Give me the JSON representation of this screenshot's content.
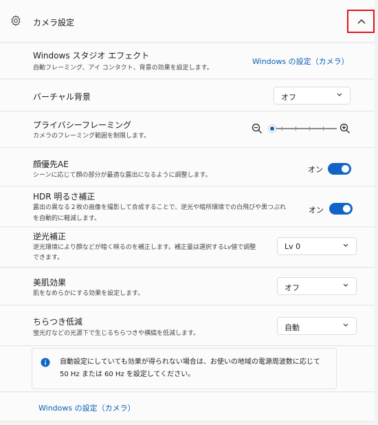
{
  "header": {
    "title": "カメラ設定"
  },
  "studio_effects": {
    "title": "Windows スタジオ エフェクト",
    "description": "自動フレーミング、アイ コンタクト、背景の効果を設定します。",
    "link": "Windows の設定（カメラ）"
  },
  "virtual_background": {
    "title": "バーチャル背景",
    "value": "オフ"
  },
  "privacy_framing": {
    "title": "プライバシーフレーミング",
    "description": "カメラのフレーミング範囲を制限します。",
    "zoom_level": 0
  },
  "face_ae": {
    "title": "顔優先AE",
    "description": "シーンに応じて顔の部分が最適な露出になるように調整します。",
    "state": "オン"
  },
  "hdr": {
    "title": "HDR 明るさ補正",
    "description_line1": "露出の異なる２枚の画像を撮影して合成することで、逆光や暗所環境での白飛びや黒つぶれ",
    "description_line2": "を自動的に軽減します。",
    "state": "オン"
  },
  "backlight": {
    "title": "逆光補正",
    "description_line1": "逆光環境により顔などが暗く映るのを補正します。補正量は選択するLv値で調整",
    "description_line2": "できます。",
    "value": "Lv 0"
  },
  "beauty": {
    "title": "美肌効果",
    "description": "肌をなめらかにする効果を設定します。",
    "value": "オフ"
  },
  "flicker": {
    "title": "ちらつき低減",
    "description": "蛍光灯などの光源下で生じるちらつきや横縞を低減します。",
    "value": "自動"
  },
  "info": {
    "line1": "自動設定にしていても効果が得られない場合は、お使いの地域の電源周波数に応じて",
    "line2": "50 Hz または 60 Hz を設定してください。"
  },
  "footer": {
    "link": "Windows の設定（カメラ）"
  },
  "colors": {
    "accent": "#0f64c6",
    "highlight_border": "#e0121d"
  }
}
